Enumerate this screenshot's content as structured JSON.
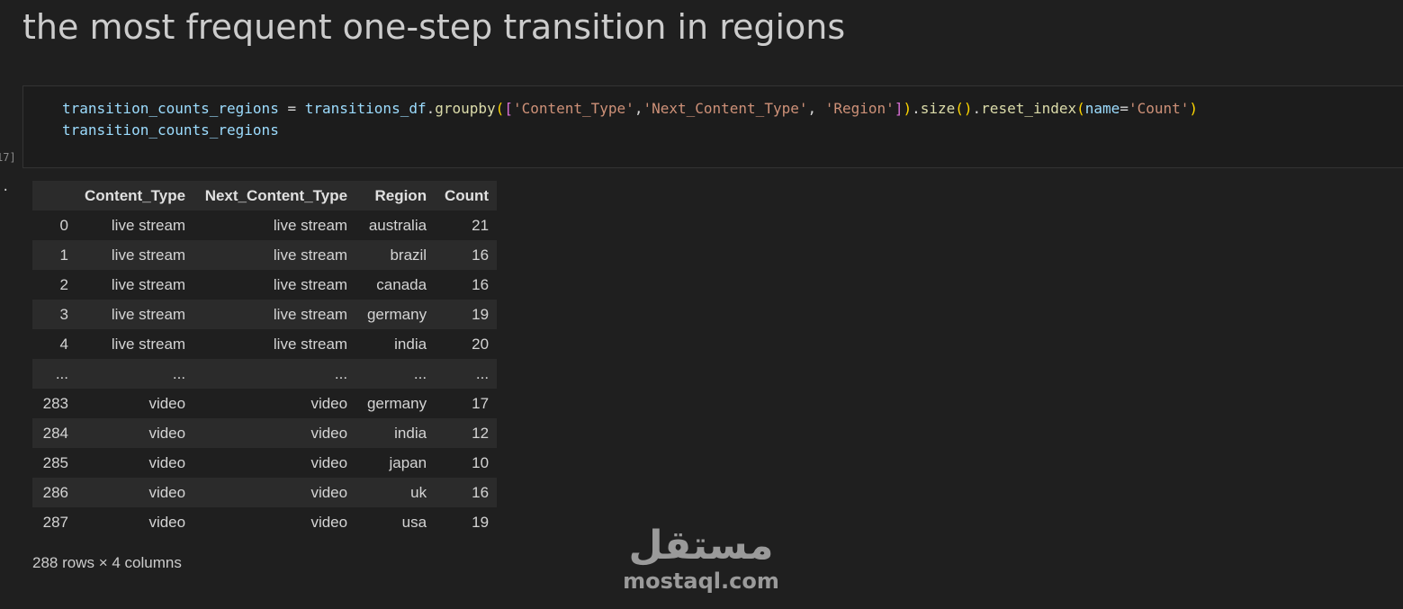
{
  "markdown": {
    "heading": "the most frequent one-step transition in regions"
  },
  "code_cell": {
    "execution_count": "17]",
    "line1": {
      "var1": "transition_counts_regions",
      "eq": " = ",
      "var2": "transitions_df",
      "dot1": ".",
      "fn1": "groupby",
      "open1": "(",
      "open2": "[",
      "s1": "'Content_Type'",
      "c1": ",",
      "s2": "'Next_Content_Type'",
      "c2": ", ",
      "s3": "'Region'",
      "close2": "]",
      "close1": ")",
      "dot2": ".",
      "fn2": "size",
      "paren2": "()",
      "dot3": ".",
      "fn3": "reset_index",
      "open3": "(",
      "kw": "name",
      "eq2": "=",
      "s4": "'Count'",
      "close3": ")"
    },
    "line2": "transition_counts_regions"
  },
  "output": {
    "marker": ".",
    "table": {
      "columns": [
        "",
        "Content_Type",
        "Next_Content_Type",
        "Region",
        "Count"
      ],
      "rows": [
        [
          "0",
          "live stream",
          "live stream",
          "australia",
          "21"
        ],
        [
          "1",
          "live stream",
          "live stream",
          "brazil",
          "16"
        ],
        [
          "2",
          "live stream",
          "live stream",
          "canada",
          "16"
        ],
        [
          "3",
          "live stream",
          "live stream",
          "germany",
          "19"
        ],
        [
          "4",
          "live stream",
          "live stream",
          "india",
          "20"
        ],
        [
          "...",
          "...",
          "...",
          "...",
          "..."
        ],
        [
          "283",
          "video",
          "video",
          "germany",
          "17"
        ],
        [
          "284",
          "video",
          "video",
          "india",
          "12"
        ],
        [
          "285",
          "video",
          "video",
          "japan",
          "10"
        ],
        [
          "286",
          "video",
          "video",
          "uk",
          "16"
        ],
        [
          "287",
          "video",
          "video",
          "usa",
          "19"
        ]
      ]
    },
    "shape_text": "288 rows × 4 columns"
  },
  "watermark": {
    "arabic": "مستقل",
    "latin": "mostaql.com"
  }
}
